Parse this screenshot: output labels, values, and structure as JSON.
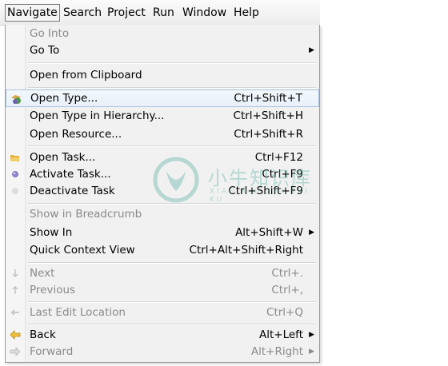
{
  "menubar": {
    "items": [
      {
        "label": "Navigate",
        "active": true
      },
      {
        "label": "Search"
      },
      {
        "label": "Project"
      },
      {
        "label": "Run"
      },
      {
        "label": "Window"
      },
      {
        "label": "Help"
      }
    ]
  },
  "menu": {
    "go_into": {
      "label": "Go Into"
    },
    "go_to": {
      "label": "Go To"
    },
    "open_from_clipboard": {
      "label": "Open from Clipboard"
    },
    "open_type": {
      "label": "Open Type...",
      "accel": "Ctrl+Shift+T"
    },
    "open_type_hierarchy": {
      "label": "Open Type in Hierarchy...",
      "accel": "Ctrl+Shift+H"
    },
    "open_resource": {
      "label": "Open Resource...",
      "accel": "Ctrl+Shift+R"
    },
    "open_task": {
      "label": "Open Task...",
      "accel": "Ctrl+F12"
    },
    "activate_task": {
      "label": "Activate Task...",
      "accel": "Ctrl+F9"
    },
    "deactivate_task": {
      "label": "Deactivate Task",
      "accel": "Ctrl+Shift+F9"
    },
    "show_in_breadcrumb": {
      "label": "Show in Breadcrumb"
    },
    "show_in": {
      "label": "Show In",
      "accel": "Alt+Shift+W"
    },
    "quick_context_view": {
      "label": "Quick Context View",
      "accel": "Ctrl+Alt+Shift+Right"
    },
    "next": {
      "label": "Next",
      "accel": "Ctrl+."
    },
    "previous": {
      "label": "Previous",
      "accel": "Ctrl+,"
    },
    "last_edit_location": {
      "label": "Last Edit Location",
      "accel": "Ctrl+Q"
    },
    "back": {
      "label": "Back",
      "accel": "Alt+Left"
    },
    "forward": {
      "label": "Forward",
      "accel": "Alt+Right"
    }
  },
  "watermark": {
    "text": "小牛知识库",
    "sub": "XIAO NIU ZHI SHI KU"
  },
  "colors": {
    "selection": "#e8f0fa",
    "disabled": "#8a8a8a",
    "watermark": "#4aa89a"
  }
}
